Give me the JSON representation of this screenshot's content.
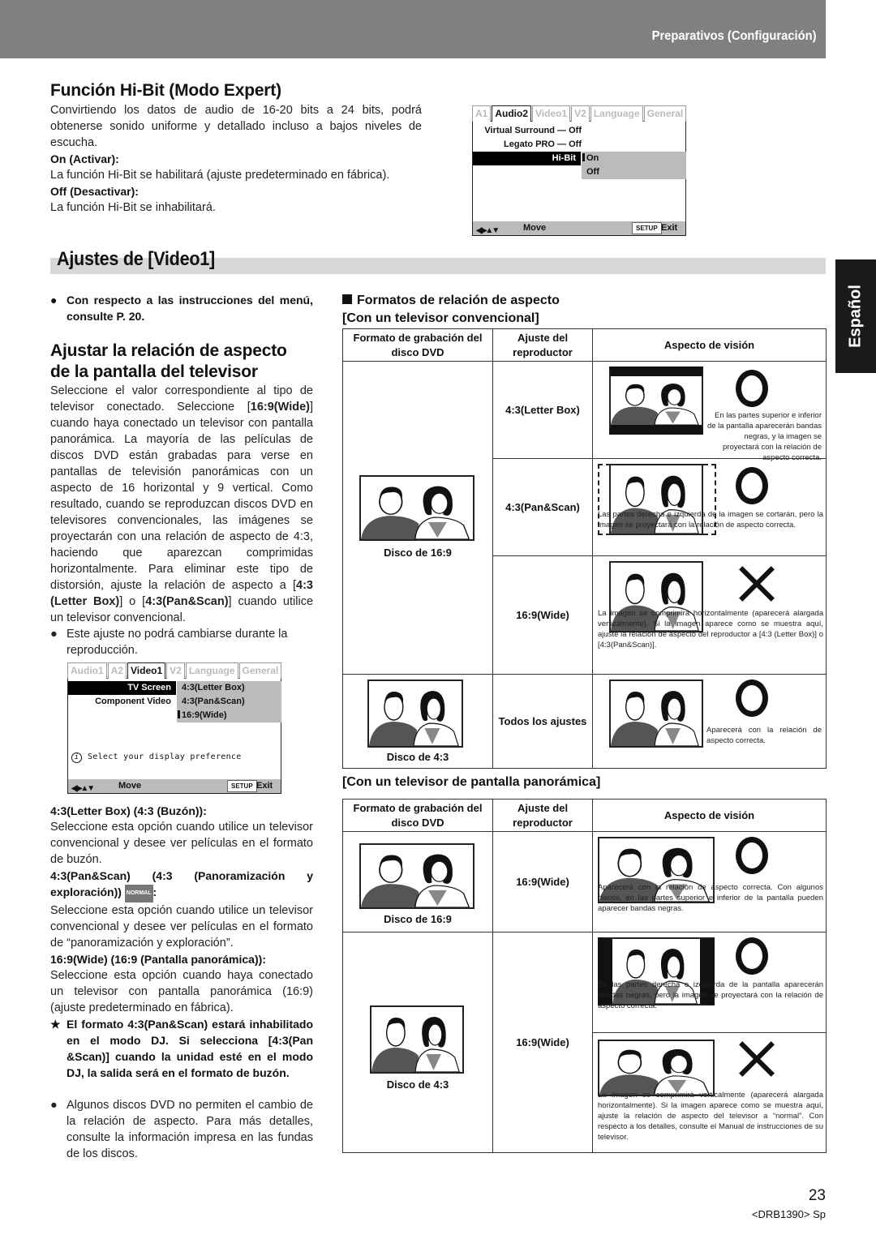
{
  "header": {
    "section": "Preparativos (Configuración)"
  },
  "hibit": {
    "title": "Función Hi-Bit (Modo Expert)",
    "intro": "Convirtiendo los datos de audio de 16-20 bits a 24 bits, podrá obtenerse sonido uniforme y detallado incluso a bajos niveles de escucha.",
    "on_label": "On (Activar):",
    "on_text": "La función Hi-Bit se habilitará (ajuste predeterminado en fábrica).",
    "off_label": "Off (Desactivar):",
    "off_text": "La función Hi-Bit se inhabilitará."
  },
  "osd_audio": {
    "tabs": [
      "A1",
      "Audio2",
      "Video1",
      "V2",
      "Language",
      "General"
    ],
    "active_tab": "Audio2",
    "rows": [
      {
        "label": "Virtual Surround",
        "value": "— Off"
      },
      {
        "label": "Legato PRO",
        "value": "— Off"
      },
      {
        "label": "Hi-Bit",
        "value": ""
      }
    ],
    "options": [
      "On",
      "Off"
    ],
    "selected_option": "On",
    "move_label": "Move",
    "setup_label": "SETUP",
    "exit_label": "Exit"
  },
  "video1": {
    "banner": "Ajustes de [Video1]"
  },
  "lang_tab": "Español",
  "left": {
    "note": "Con respecto a las instrucciones del menú, consulte P. 20.",
    "subtitle_1": "Ajustar la relación de aspecto",
    "subtitle_2": "de la pantalla del televisor",
    "para_a": "Seleccione el valor correspondiente al tipo de televisor conectado. Seleccione [",
    "para_b": "16:9(Wide)",
    "para_c": "] cuando haya conectado un televisor con pantalla panorámica. La mayoría de las películas de discos DVD están grabadas para verse en pantallas de televisión panorámicas con un aspecto de 16 horizontal y 9 vertical. Como resultado, cuando se reproduzcan discos DVD en televisores convencionales, las imágenes se proyectarán con una relación de aspecto de 4:3, haciendo que aparezcan comprimidas horizontalmente. Para eliminar este tipo de distorsión, ajuste la relación de aspecto a [",
    "para_d": "4:3 (Letter Box)",
    "para_e": "] o [",
    "para_f": "4:3(Pan&Scan)",
    "para_g": "] cuando utilice un televisor convencional.",
    "bullet_2": "Este ajuste no podrá cambiarse durante la reproducción.",
    "lb_label": "4:3(Letter Box) (4:3 (Buzón)):",
    "lb_text": "Seleccione esta opción cuando utilice un televisor convencional y desee ver películas en el formato de buzón.",
    "ps_label": "4:3(Pan&Scan) (4:3 (Panoramización y exploración))",
    "ps_badge": "NORMAL",
    "ps_text": "Seleccione esta opción cuando utilice un televisor convencional y desee ver películas en el formato de “panoramización y exploración”.",
    "wide_label": "16:9(Wide) (16:9 (Pantalla panorámica)):",
    "wide_text": "Seleccione esta opción cuando haya conectado un televisor con pantalla panorámica (16:9) (ajuste predeterminado en fábrica).",
    "star_note": "El formato 4:3(Pan&Scan) estará inhabilitado en el modo DJ. Si selecciona [4:3(Pan &Scan)] cuando la unidad esté en el modo DJ, la salida será en el formato de buzón.",
    "bullet_3": "Algunos discos DVD no permiten el cambio de la relación de aspecto. Para más detalles, consulte la información impresa en las fundas de los discos."
  },
  "osd_video": {
    "tabs": [
      "Audio1",
      "A2",
      "Video1",
      "V2",
      "Language",
      "General"
    ],
    "active_tab": "Video1",
    "rows": [
      {
        "label": "TV Screen"
      },
      {
        "label": "Component Video"
      }
    ],
    "options": [
      "4:3(Letter Box)",
      "4:3(Pan&Scan)",
      "16:9(Wide)"
    ],
    "selected_option": "16:9(Wide)",
    "hint": "Select your display preference",
    "move_label": "Move",
    "setup_label": "SETUP",
    "exit_label": "Exit"
  },
  "formats": {
    "title": "Formatos de relación de aspecto",
    "conv_title": "[Con un televisor convencional]",
    "wide_title": "[Con un televisor de pantalla panorámica]",
    "col1": "Formato de grabación del disco DVD",
    "col2": "Ajuste del reproductor",
    "col3": "Aspecto de visión",
    "conv_rows": [
      {
        "disc": "Disco de 16:9",
        "setting": "4:3(Letter Box)",
        "result": "ok",
        "desc": "En las partes superior e inferior de la pantalla aparecerán bandas negras, y la imagen se proyectará con la relación de aspecto correcta."
      },
      {
        "disc": "Disco de 16:9",
        "setting": "4:3(Pan&Scan)",
        "result": "ok",
        "desc": "Las partes derecha e izquierda de la imagen se cortarán, pero la imagen se proyectará con la relación de aspecto correcta."
      },
      {
        "disc": "Disco de 16:9",
        "setting": "16:9(Wide)",
        "result": "bad",
        "desc": "La imagen se comprimirá horizontalmente (aparecerá alargada verticalmente). Si la imagen aparece como se muestra aquí, ajuste la relación de aspecto del reproductor a [4:3 (Letter Box)] o [4:3(Pan&Scan)]."
      },
      {
        "disc": "Disco de 4:3",
        "setting": "Todos los ajustes",
        "result": "ok",
        "desc": "Aparecerá con la relación de aspecto correcta."
      }
    ],
    "wide_rows": [
      {
        "disc": "Disco de 16:9",
        "setting": "16:9(Wide)",
        "result": "ok",
        "desc": "Aparecerá con la relación de aspecto correcta. Con algunos discos, en las partes superior e inferior de la pantalla pueden aparecer bandas negras."
      },
      {
        "disc": "Disco de 4:3",
        "setting": "16:9(Wide)",
        "result": "ok",
        "desc": "En las partes derecha e izquierda de la pantalla aparecerán bandas negras, pero la imagen se proyectará con la relación de aspecto correcta."
      },
      {
        "disc": "Disco de 4:3",
        "setting": "16:9(Wide)",
        "result": "bad",
        "desc": "La imagen se comprimirá verticalmente (aparecerá alargada horizontalmente). Si la imagen aparece como se muestra aquí, ajuste la relación de aspecto del televisor a “normal”. Con respecto a los detalles, consulte el Manual de instrucciones de su televisor."
      }
    ]
  },
  "footer": {
    "page": "23",
    "code": "<DRB1390> Sp"
  }
}
